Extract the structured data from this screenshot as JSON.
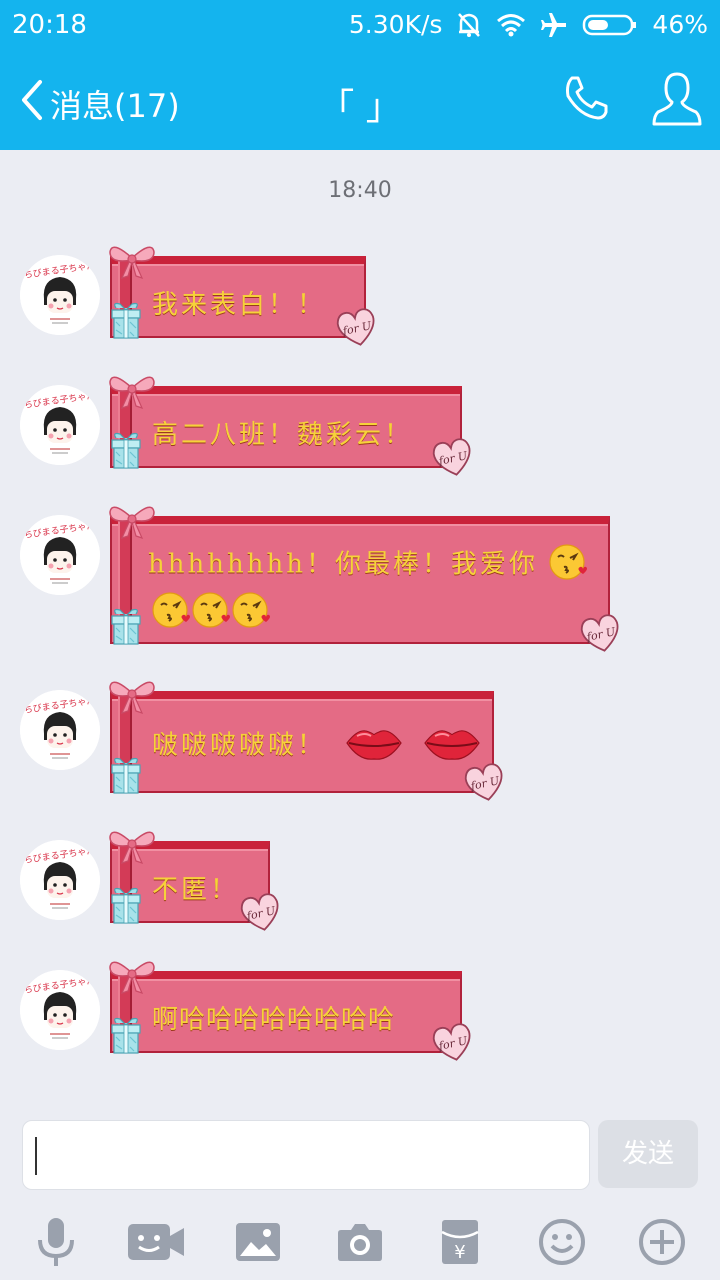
{
  "status_bar": {
    "time": "20:18",
    "network_speed": "5.30K/s",
    "battery": "46%",
    "battery_level": 0.46,
    "icons": [
      "mute-bell-icon",
      "wifi-icon",
      "airplane-icon",
      "battery-icon"
    ]
  },
  "header": {
    "back_label": "消息(17)",
    "title": "「  」",
    "icons": [
      "back-chevron-icon",
      "phone-icon",
      "user-profile-icon"
    ]
  },
  "chat": {
    "timestamp": "18:40",
    "messages": [
      {
        "text": "我来表白！！"
      },
      {
        "text": "高二八班！魏彩云！"
      },
      {
        "text_line1": "hhhhhhhh！你最棒！我爱你",
        "emoji_line1": "kiss-face-emoji",
        "emoji_line2": [
          "kiss-face-emoji",
          "kiss-face-emoji",
          "kiss-face-emoji"
        ]
      },
      {
        "text": "啵啵啵啵啵！",
        "emoji": [
          "lips-emoji",
          "lips-emoji"
        ]
      },
      {
        "text": "不匿！"
      },
      {
        "text": "啊哈哈哈哈哈哈哈哈"
      }
    ],
    "bubble_sticker_text": "for U",
    "avatar_caption": "ちびまる子ちゃん"
  },
  "input_bar": {
    "placeholder": "",
    "send_label": "发送"
  },
  "toolbar": {
    "icons": [
      "microphone-icon",
      "video-icon",
      "image-icon",
      "camera-icon",
      "red-packet-icon",
      "emoji-icon",
      "plus-icon"
    ]
  },
  "colors": {
    "header_bg": "#14b4ee",
    "bubble_bg": "#e46b85",
    "bubble_text": "#f6d23a",
    "chat_bg": "#ebedf3"
  }
}
